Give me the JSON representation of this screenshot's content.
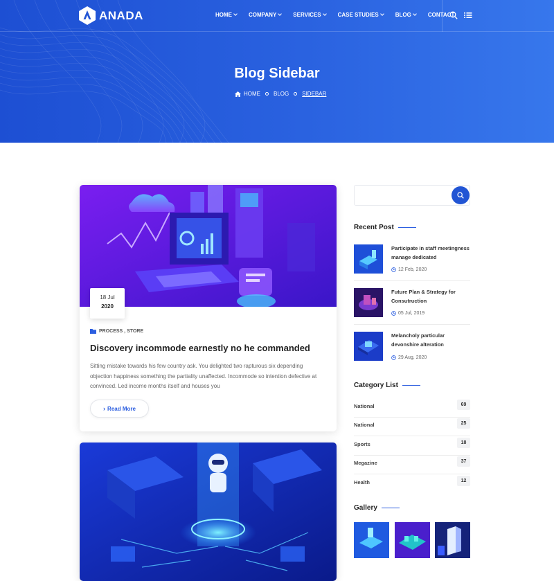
{
  "brand": {
    "name": "ANADA"
  },
  "nav": {
    "items": [
      {
        "label": "HOME",
        "dropdown": true
      },
      {
        "label": "COMPANY",
        "dropdown": true
      },
      {
        "label": "SERVICES",
        "dropdown": true
      },
      {
        "label": "CASE STUDIES",
        "dropdown": true
      },
      {
        "label": "BLOG",
        "dropdown": true
      },
      {
        "label": "CONTACT",
        "dropdown": false
      }
    ],
    "icons": [
      "search-icon",
      "list-menu-icon"
    ]
  },
  "hero": {
    "title": "Blog Sidebar",
    "breadcrumb": [
      "HOME",
      "BLOG",
      "SIDEBAR"
    ]
  },
  "posts": [
    {
      "date_day": "18 Jul",
      "date_year": "2020",
      "categories": "PROCESS , STORE",
      "title": "Discovery incommode earnestly no he commanded",
      "excerpt": "Sitting mistake towards his few country ask. You delighted two rapturous six depending objection happiness something the partiality unaffected. Incommode so intention defective at convinced. Led income months itself and houses you",
      "read_more": "Read More"
    }
  ],
  "sidebar": {
    "search": {
      "placeholder": "",
      "value": ""
    },
    "recent_title": "Recent Post",
    "recent_posts": [
      {
        "title": "Participate in staff meetingness manage dedicated",
        "date": "12 Feb, 2020"
      },
      {
        "title": "Future Plan & Strategy for Consutruction",
        "date": "05 Jul, 2019"
      },
      {
        "title": "Melancholy particular devonshire alteration",
        "date": "29 Aug, 2020"
      }
    ],
    "category_title": "Category List",
    "categories": [
      {
        "name": "National",
        "count": "69"
      },
      {
        "name": "National",
        "count": "25"
      },
      {
        "name": "Sports",
        "count": "18"
      },
      {
        "name": "Megazine",
        "count": "37"
      },
      {
        "name": "Health",
        "count": "12"
      }
    ],
    "gallery_title": "Gallery"
  },
  "colors": {
    "primary": "#2255d4",
    "hero_start": "#1d4fd3",
    "hero_end": "#3777ec",
    "heading": "#232323",
    "body_text": "#666666"
  }
}
